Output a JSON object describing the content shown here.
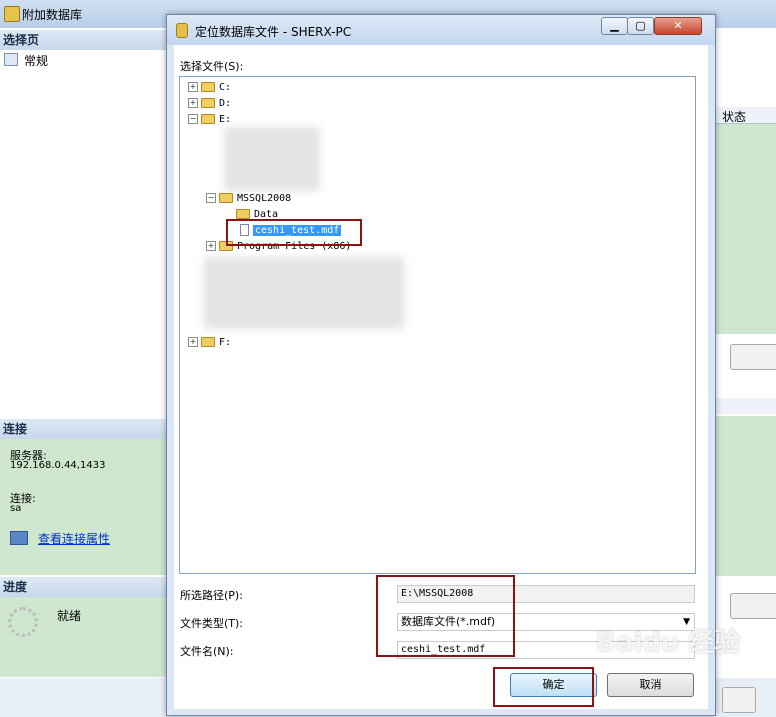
{
  "background_window": {
    "title": "附加数据库",
    "select_page_header": "选择页",
    "pages": [
      "常规"
    ],
    "connection_header": "连接",
    "server_label": "服务器:",
    "server_value": "192.168.0.44,1433",
    "connection_label": "连接:",
    "connection_value": "sa",
    "view_connection_link": "查看连接属性",
    "progress_header": "进度",
    "progress_status": "就绪",
    "status_column": "状态"
  },
  "dialog": {
    "title": "定位数据库文件 - SHERX-PC",
    "select_file_label": "选择文件(S):",
    "tree": [
      {
        "label": "C:",
        "level": 0,
        "expanded": false
      },
      {
        "label": "D:",
        "level": 0,
        "expanded": false
      },
      {
        "label": "E:",
        "level": 0,
        "expanded": true
      },
      {
        "label": "MSSQL2008",
        "level": 1,
        "expanded": true
      },
      {
        "label": "Data",
        "level": 2
      },
      {
        "label": "ceshi_test.mdf",
        "level": 2,
        "selected": true
      },
      {
        "label": "Program Files (x86)",
        "level": 1,
        "expanded": false
      },
      {
        "label": "F:",
        "level": 0,
        "expanded": false
      }
    ],
    "selected_path_label": "所选路径(P):",
    "selected_path_value": "E:\\MSSQL2008",
    "file_type_label": "文件类型(T):",
    "file_type_value": "数据库文件(*.mdf)",
    "file_name_label": "文件名(N):",
    "file_name_value": "ceshi_test.mdf",
    "ok_button": "确定",
    "cancel_button": "取消"
  },
  "watermark": "Baidu 经验",
  "colors": {
    "selection": "#3399ff",
    "highlight_box": "#8b1313",
    "section_bg": "#cfe6cf"
  }
}
